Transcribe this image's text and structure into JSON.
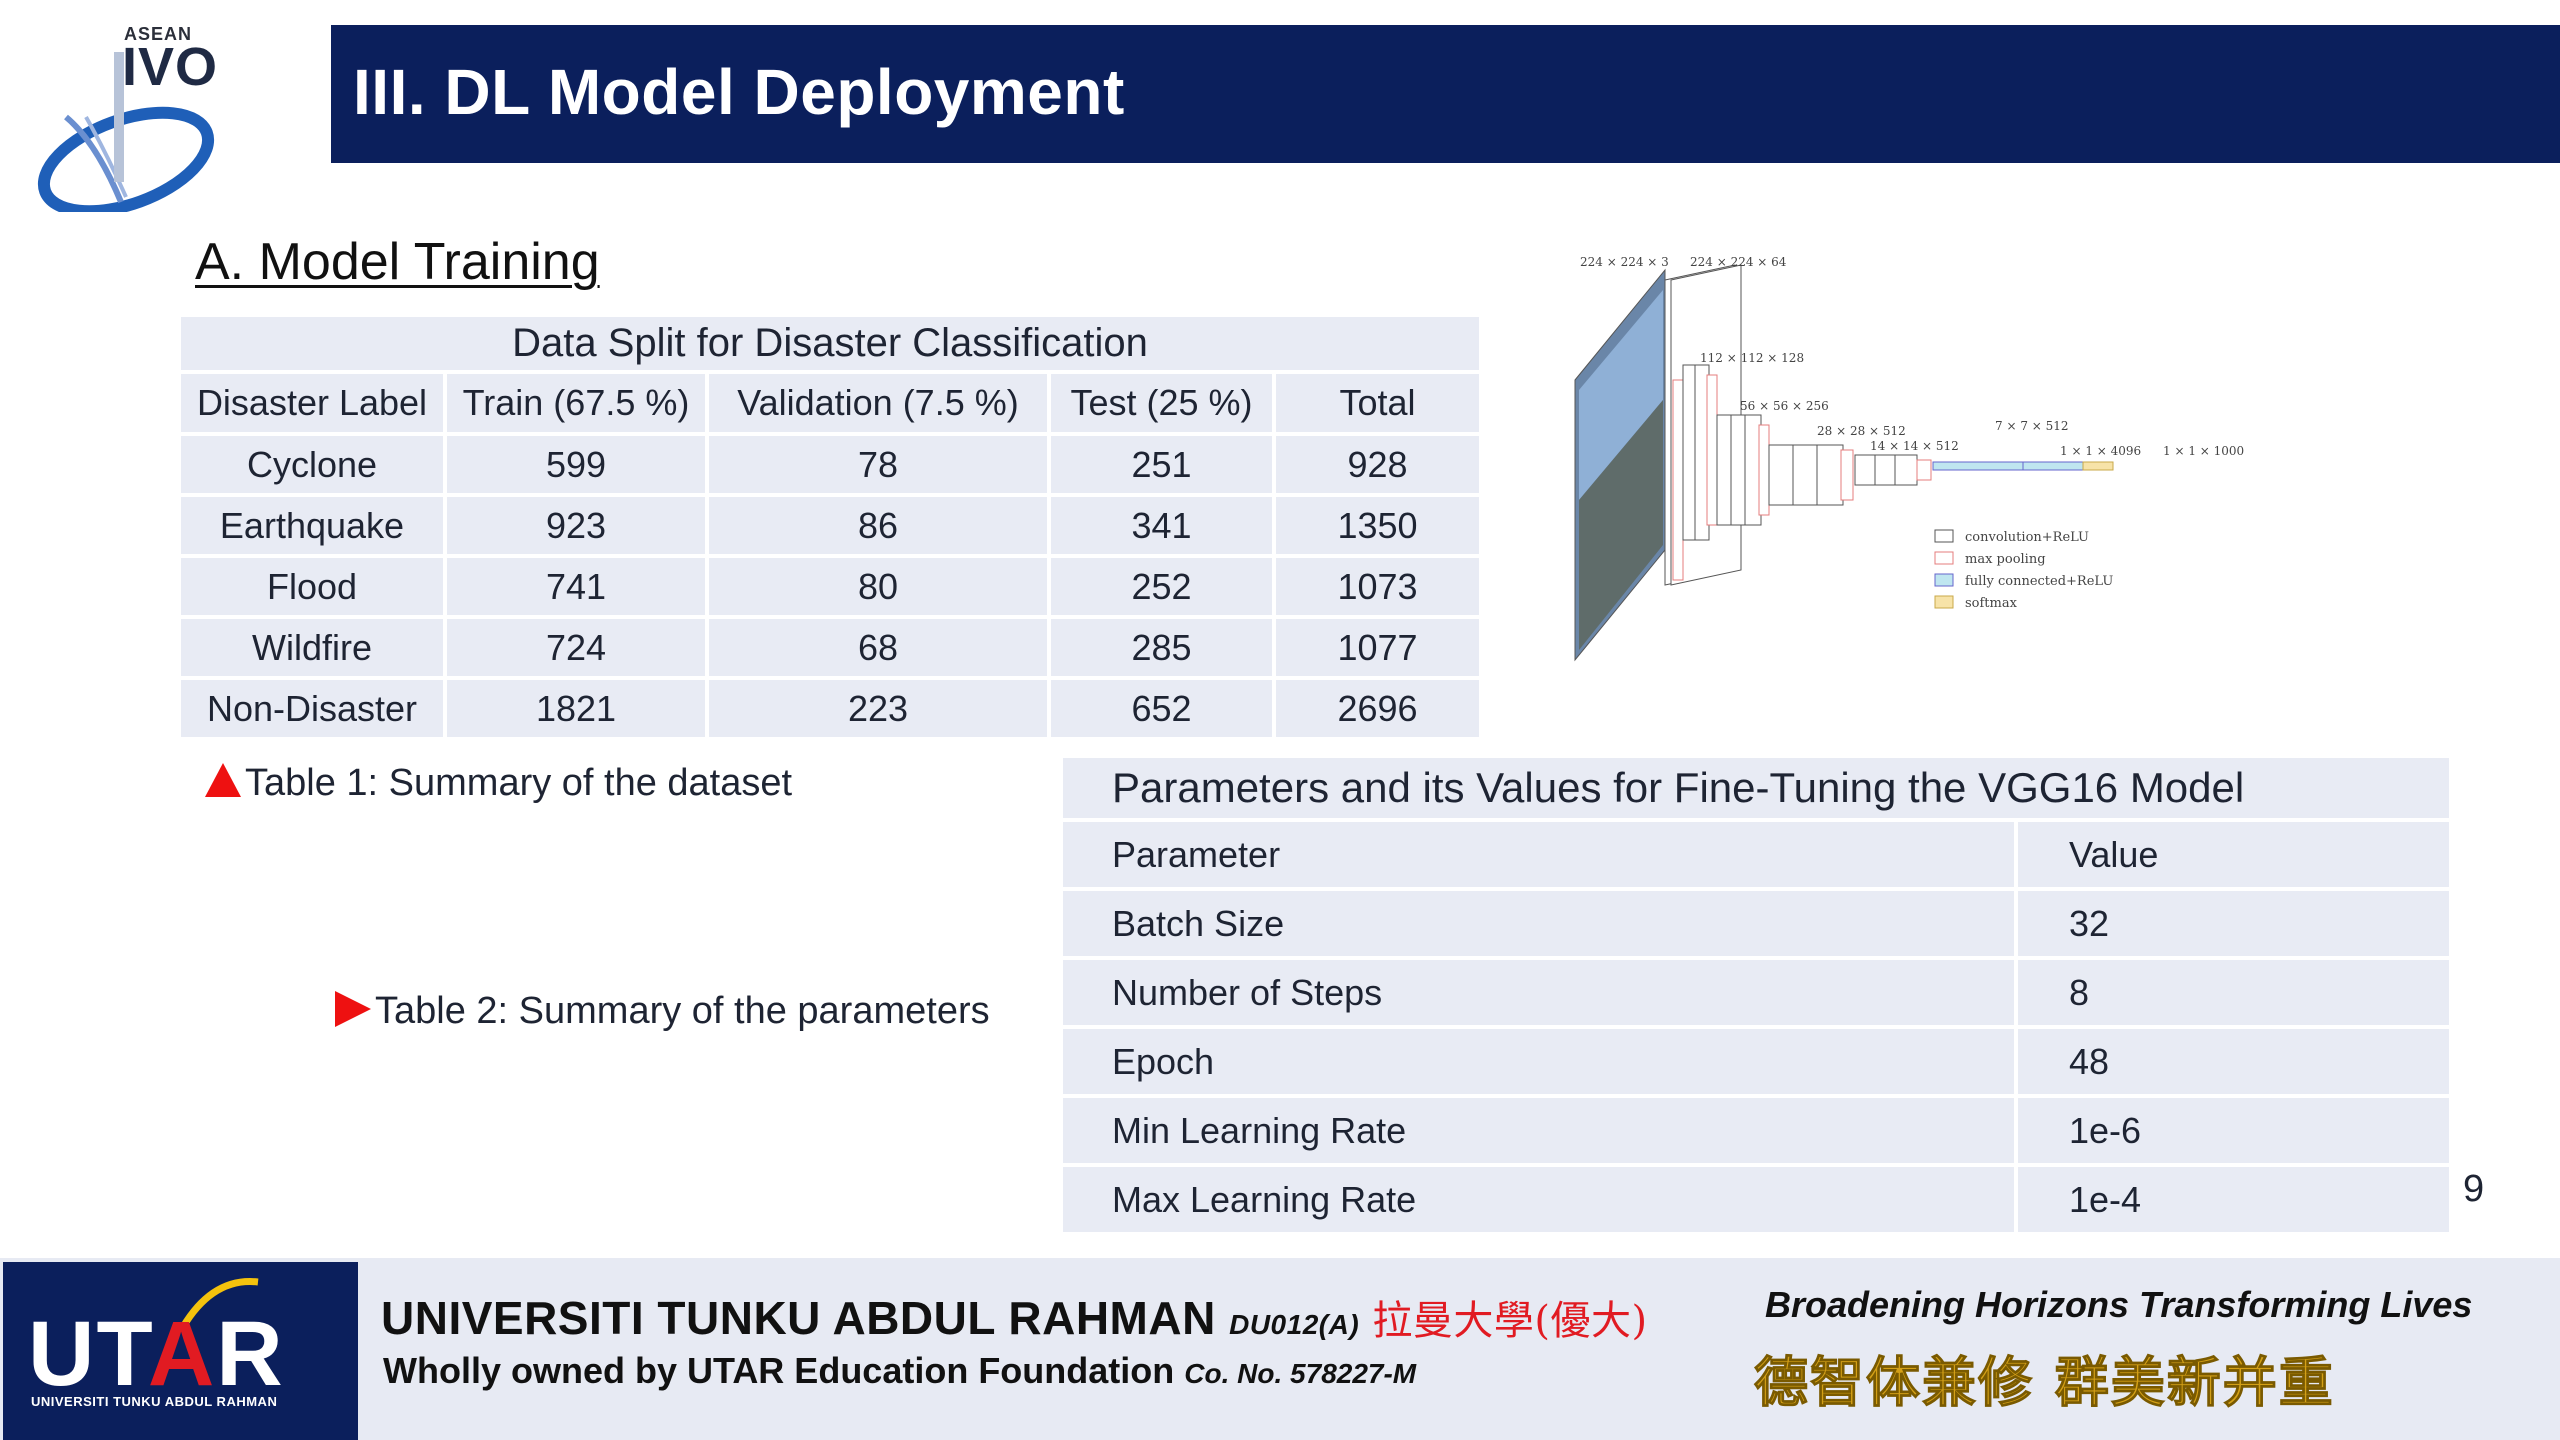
{
  "header": {
    "logo_asean": "ASEAN",
    "logo_ivo": "IVO",
    "title": "III. DL Model Deployment",
    "colors": {
      "title_bar": "#0b1f5c",
      "title_text": "#ffffff"
    }
  },
  "section": {
    "heading": "A. Model Training"
  },
  "table1": {
    "caption": "Data Split for Disaster Classification",
    "columns": [
      "Disaster Label",
      "Train (67.5 %)",
      "Validation (7.5 %)",
      "Test (25 %)",
      "Total"
    ],
    "rows": [
      [
        "Cyclone",
        "599",
        "78",
        "251",
        "928"
      ],
      [
        "Earthquake",
        "923",
        "86",
        "341",
        "1350"
      ],
      [
        "Flood",
        "741",
        "80",
        "252",
        "1073"
      ],
      [
        "Wildfire",
        "724",
        "68",
        "285",
        "1077"
      ],
      [
        "Non-Disaster",
        "1821",
        "223",
        "652",
        "2696"
      ]
    ],
    "label": "Table 1: Summary of the dataset"
  },
  "table2": {
    "caption": "Parameters and its Values for Fine-Tuning the VGG16 Model",
    "columns": [
      "Parameter",
      "Value"
    ],
    "rows": [
      [
        "Batch Size",
        "32"
      ],
      [
        "Number of Steps",
        "8"
      ],
      [
        "Epoch",
        "48"
      ],
      [
        "Min Learning Rate",
        "1e-6"
      ],
      [
        "Max Learning Rate",
        "1e-4"
      ]
    ],
    "label": "Table 2: Summary of the parameters"
  },
  "diagram": {
    "dims": [
      "224 × 224 × 3",
      "224 × 224 × 64",
      "112 × 112 × 128",
      "56 × 56 × 256",
      "28 × 28 × 512",
      "14 × 14 × 512",
      "7 × 7 × 512",
      "1 × 1 × 4096",
      "1 × 1 × 1000"
    ],
    "legend": [
      "convolution+ReLU",
      "max pooling",
      "fully connected+ReLU",
      "softmax"
    ]
  },
  "page_number": "9",
  "footer": {
    "utar_logo": "UTAR",
    "utar_logo_sub": "UNIVERSITI TUNKU ABDUL RAHMAN",
    "university": "UNIVERSITI TUNKU ABDUL RAHMAN",
    "reg_code": "DU012(A)",
    "chinese_name": "拉曼大學(優大)",
    "owned_by": "Wholly owned by UTAR Education Foundation",
    "company_no": "Co. No. 578227-M",
    "motto": "Broadening Horizons  Transforming Lives",
    "motto_cn": "德智体兼修 群美新并重"
  }
}
